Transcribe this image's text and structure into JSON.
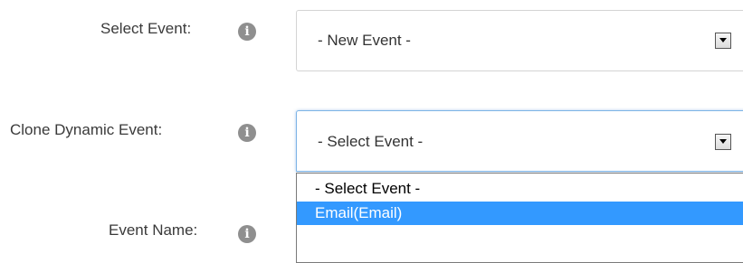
{
  "form": {
    "select_event": {
      "label": "Select Event:",
      "icon": "info-icon",
      "value": "- New Event -"
    },
    "clone_dynamic_event": {
      "label": "Clone Dynamic Event:",
      "icon": "info-icon",
      "value": "- Select Event -",
      "options": [
        "- Select Event -",
        "Email(Email)"
      ],
      "highlighted_option": "Email(Email)"
    },
    "event_name": {
      "label": "Event Name:",
      "icon": "info-icon"
    }
  },
  "info_glyph": "i",
  "colors": {
    "highlight": "#3399ff",
    "focus_border": "#7db4e6",
    "icon_gray": "#8f8f8f"
  }
}
